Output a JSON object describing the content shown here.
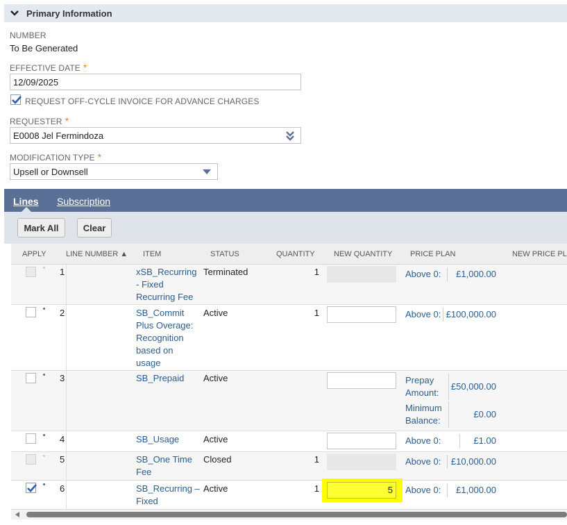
{
  "section": {
    "title": "Primary Information"
  },
  "fields": {
    "number_label": "NUMBER",
    "number_value": "To Be Generated",
    "effective_date_label": "EFFECTIVE DATE",
    "effective_date_value": "12/09/2025",
    "offcycle_label": "REQUEST OFF-CYCLE INVOICE FOR ADVANCE CHARGES",
    "offcycle_checked": true,
    "requester_label": "REQUESTER",
    "requester_value": "E0008 Jel Fermindoza",
    "modtype_label": "MODIFICATION TYPE",
    "modtype_value": "Upsell or Downsell",
    "required_mark": "*"
  },
  "tabs": [
    {
      "label": "Lines",
      "active": true
    },
    {
      "label": "Subscription",
      "active": false
    }
  ],
  "buttons": {
    "mark_all": "Mark All",
    "clear": "Clear"
  },
  "table": {
    "columns": [
      "APPLY",
      "LINE NUMBER ▲",
      "ITEM",
      "STATUS",
      "QUANTITY",
      "NEW QUANTITY",
      "PRICE PLAN",
      "NEW PRICE PLA"
    ],
    "rows": [
      {
        "line": "1",
        "item": "xSB_Recurring - Fixed Recurring Fee",
        "status": "Terminated",
        "quantity": "1",
        "new_quantity": "",
        "new_qty_state": "disabled",
        "checked": false,
        "apply_disabled": true,
        "price_plan": [
          {
            "label": "Above 0:",
            "value": "£1,000.00"
          }
        ]
      },
      {
        "line": "2",
        "item": "SB_Commit Plus Overage: Recognition based on usage",
        "status": "Active",
        "quantity": "1",
        "new_quantity": "",
        "new_qty_state": "editable",
        "checked": false,
        "apply_disabled": false,
        "price_plan": [
          {
            "label": "Above 0:",
            "value": "£100,000.00"
          }
        ]
      },
      {
        "line": "3",
        "item": "SB_Prepaid",
        "status": "Active",
        "quantity": "",
        "new_quantity": "",
        "new_qty_state": "editable",
        "checked": false,
        "apply_disabled": false,
        "price_plan": [
          {
            "label": "Prepay Amount:",
            "value": "£50,000.00"
          },
          {
            "label": "Minimum Balance:",
            "value": "£0.00"
          }
        ]
      },
      {
        "line": "4",
        "item": "SB_Usage",
        "status": "Active",
        "quantity": "",
        "new_quantity": "",
        "new_qty_state": "editable",
        "checked": false,
        "apply_disabled": false,
        "price_plan": [
          {
            "label": "Above 0:",
            "value": "£1.00"
          }
        ]
      },
      {
        "line": "5",
        "item": "SB_One Time Fee",
        "status": "Closed",
        "quantity": "1",
        "new_quantity": "",
        "new_qty_state": "disabled",
        "checked": false,
        "apply_disabled": true,
        "price_plan": [
          {
            "label": "Above 0:",
            "value": "£10,000.00"
          }
        ]
      },
      {
        "line": "6",
        "item": "SB_Recurring – Fixed",
        "status": "Active",
        "quantity": "1",
        "new_quantity": "5",
        "new_qty_state": "highlighted",
        "checked": true,
        "apply_disabled": false,
        "price_plan": [
          {
            "label": "Above 0:",
            "value": "£1,000.00"
          }
        ]
      }
    ]
  },
  "colors": {
    "accent": "#5b7096",
    "link": "#2a5d8f",
    "required": "#e88a1a",
    "highlight": "#ffff00"
  }
}
